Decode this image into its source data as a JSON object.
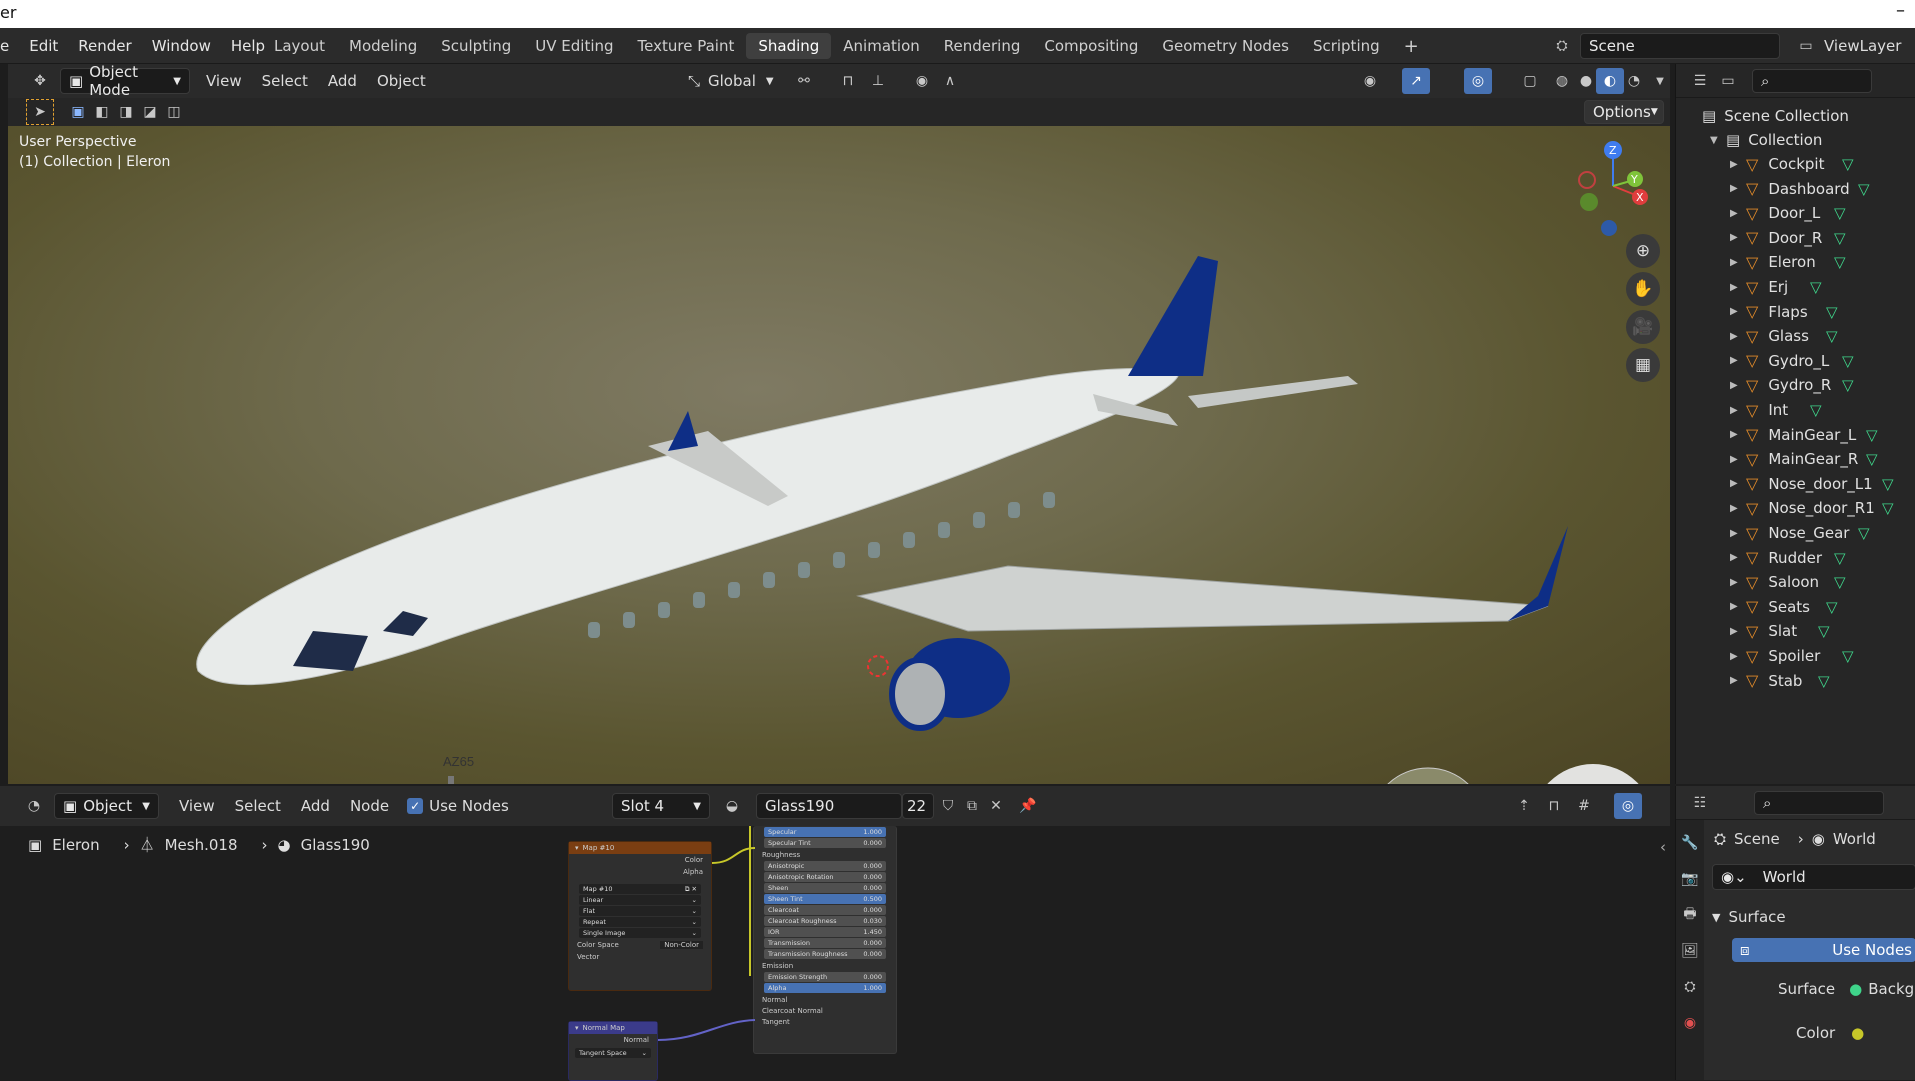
{
  "app_title_partial": "er",
  "menus": [
    "e",
    "Edit",
    "Render",
    "Window",
    "Help"
  ],
  "workspace_tabs": [
    "Layout",
    "Modeling",
    "Sculpting",
    "UV Editing",
    "Texture Paint",
    "Shading",
    "Animation",
    "Rendering",
    "Compositing",
    "Geometry Nodes",
    "Scripting"
  ],
  "active_tab": "Shading",
  "scene_name": "Scene",
  "view_layer": "ViewLayer",
  "viewport": {
    "mode": "Object Mode",
    "menu": [
      "View",
      "Select",
      "Add",
      "Object"
    ],
    "transform_orientation": "Global",
    "options_label": "Options",
    "info_line1": "User Perspective",
    "info_line2": "(1) Collection | Eleron",
    "gizmo": {
      "z": "Z",
      "y": "Y",
      "x": "X"
    },
    "aircraft_reg": "AZ65"
  },
  "outliner": {
    "scene_collection": "Scene Collection",
    "collection": "Collection",
    "items": [
      "Cockpit",
      "Dashboard",
      "Door_L",
      "Door_R",
      "Eleron",
      "Erj",
      "Flaps",
      "Glass",
      "Gydro_L",
      "Gydro_R",
      "Int",
      "MainGear_L",
      "MainGear_R",
      "Nose_door_L1",
      "Nose_door_R1",
      "Nose_Gear",
      "Rudder",
      "Saloon",
      "Seats",
      "Slat",
      "Spoiler",
      "Stab"
    ]
  },
  "node_editor": {
    "type": "Object",
    "menu": [
      "View",
      "Select",
      "Add",
      "Node"
    ],
    "use_nodes_label": "Use Nodes",
    "slot": "Slot 4",
    "material": "Glass190",
    "user_count": "22",
    "breadcrumb": [
      "Eleron",
      "Mesh.018",
      "Glass190"
    ],
    "image_node": {
      "title": "Map #10",
      "outputs": [
        "Color",
        "Alpha"
      ],
      "image_name": "Map #10",
      "interpolation": "Linear",
      "projection": "Flat",
      "extension": "Repeat",
      "source": "Single Image",
      "color_space_label": "Color Space",
      "color_space": "Non-Color",
      "input": "Vector"
    },
    "normal_node": {
      "title": "Normal Map",
      "output": "Normal",
      "space": "Tangent Space"
    },
    "bsdf_rows": [
      {
        "label": "Specular",
        "value": "1.000",
        "blue": true
      },
      {
        "label": "Specular Tint",
        "value": "0.000",
        "blue": false
      },
      {
        "label": "Roughness",
        "value": "",
        "blue": false
      },
      {
        "label": "Anisotropic",
        "value": "0.000",
        "blue": false
      },
      {
        "label": "Anisotropic Rotation",
        "value": "0.000",
        "blue": false
      },
      {
        "label": "Sheen",
        "value": "0.000",
        "blue": false
      },
      {
        "label": "Sheen Tint",
        "value": "0.500",
        "blue": true
      },
      {
        "label": "Clearcoat",
        "value": "0.000",
        "blue": false
      },
      {
        "label": "Clearcoat Roughness",
        "value": "0.030",
        "blue": false
      },
      {
        "label": "IOR",
        "value": "1.450",
        "blue": false
      },
      {
        "label": "Transmission",
        "value": "0.000",
        "blue": false
      },
      {
        "label": "Transmission Roughness",
        "value": "0.000",
        "blue": false
      },
      {
        "label": "Emission",
        "value": "",
        "blue": false
      },
      {
        "label": "Emission Strength",
        "value": "0.000",
        "blue": false
      },
      {
        "label": "Alpha",
        "value": "1.000",
        "blue": true
      },
      {
        "label": "Normal",
        "value": "",
        "blue": false
      },
      {
        "label": "Clearcoat Normal",
        "value": "",
        "blue": false
      },
      {
        "label": "Tangent",
        "value": "",
        "blue": false
      }
    ]
  },
  "properties": {
    "breadcrumb": [
      "Scene",
      "World"
    ],
    "world": "World",
    "surface_panel": "Surface",
    "use_nodes_button": "Use Nodes",
    "surface_label": "Surface",
    "surface_value": "Backgro",
    "color_label": "Color"
  }
}
